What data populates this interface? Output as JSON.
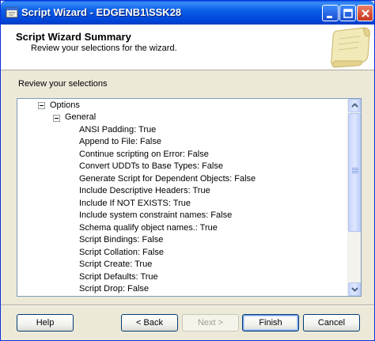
{
  "window": {
    "title": "Script Wizard - EDGENB1\\SSK28"
  },
  "header": {
    "title": "Script Wizard Summary",
    "subtitle": "Review your selections for the wizard."
  },
  "review_label": "Review your selections",
  "tree": {
    "options_label": "Options",
    "general_label": "General",
    "items": [
      "ANSI Padding: True",
      "Append to File: False",
      "Continue scripting on Error: False",
      "Convert UDDTs to Base Types: False",
      "Generate Script for Dependent Objects: False",
      "Include Descriptive Headers: True",
      "Include If NOT EXISTS: True",
      "Include system constraint names: False",
      "Schema qualify object names.: True",
      "Script Bindings: False",
      "Script Collation: False",
      "Script Create: True",
      "Script Defaults: True",
      "Script Drop: False"
    ]
  },
  "buttons": {
    "help": "Help",
    "back": "< Back",
    "next": "Next >",
    "finish": "Finish",
    "cancel": "Cancel"
  },
  "icons": {
    "title": "wizard-window-icon",
    "header_art": "scroll-paper-icon",
    "minimize": "minimize-icon",
    "maximize": "maximize-icon",
    "close": "close-icon",
    "scroll_up": "arrow-up-icon",
    "scroll_down": "arrow-down-icon"
  },
  "colors": {
    "titlebar": "#0a5ee8",
    "dialog_bg": "#ece9d8",
    "close_button": "#d9533a"
  }
}
